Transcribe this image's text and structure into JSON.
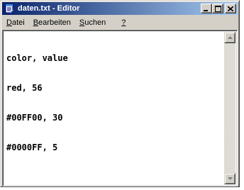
{
  "window": {
    "title": "daten.txt - Editor",
    "controls": [
      "minimize",
      "maximize",
      "close"
    ]
  },
  "menu": {
    "items": [
      {
        "access_key": "D",
        "rest": "atei"
      },
      {
        "access_key": "B",
        "rest": "earbeiten"
      },
      {
        "access_key": "S",
        "rest": "uchen"
      },
      {
        "access_key": "?",
        "rest": ""
      }
    ]
  },
  "editor": {
    "lines": [
      "color, value",
      "red, 56",
      "#00FF00, 30",
      "#0000FF, 5"
    ]
  },
  "icons": {
    "app": "notepad-icon",
    "minimize": "minimize-icon",
    "maximize": "maximize-icon",
    "close": "close-icon",
    "scroll_up": "scroll-up-arrow-icon",
    "scroll_down": "scroll-down-arrow-icon"
  },
  "colors": {
    "title_start": "#0a246a",
    "title_end": "#a6caf0",
    "face": "#d4d0c8"
  }
}
